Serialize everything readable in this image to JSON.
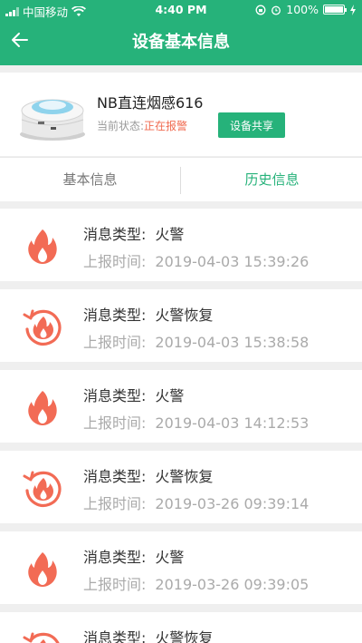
{
  "status_bar": {
    "carrier": "中国移动",
    "time": "4:40 PM",
    "battery": "100%"
  },
  "nav": {
    "title": "设备基本信息"
  },
  "device": {
    "name": "NB直连烟感616",
    "status_label": "当前状态:",
    "status_value": "正在报警",
    "share_label": "设备共享"
  },
  "tabs": {
    "basic": "基本信息",
    "history": "历史信息"
  },
  "records": [
    {
      "type_label": "消息类型:",
      "type": "火警",
      "time_label": "上报时间:",
      "time": "2019-04-03 15:39:26",
      "icon": "fire-icon"
    },
    {
      "type_label": "消息类型:",
      "type": "火警恢复",
      "time_label": "上报时间:",
      "time": "2019-04-03 15:38:58",
      "icon": "fire-restore-icon"
    },
    {
      "type_label": "消息类型:",
      "type": "火警",
      "time_label": "上报时间:",
      "time": "2019-04-03 14:12:53",
      "icon": "fire-icon"
    },
    {
      "type_label": "消息类型:",
      "type": "火警恢复",
      "time_label": "上报时间:",
      "time": "2019-03-26 09:39:14",
      "icon": "fire-restore-icon"
    },
    {
      "type_label": "消息类型:",
      "type": "火警",
      "time_label": "上报时间:",
      "time": "2019-03-26 09:39:05",
      "icon": "fire-icon"
    },
    {
      "type_label": "消息类型:",
      "type": "火警恢复",
      "time_label": "",
      "time": "",
      "icon": "fire-restore-icon"
    }
  ],
  "colors": {
    "brand": "#26b27a",
    "alarm": "#f06a4f",
    "icon": "#f26b55"
  }
}
